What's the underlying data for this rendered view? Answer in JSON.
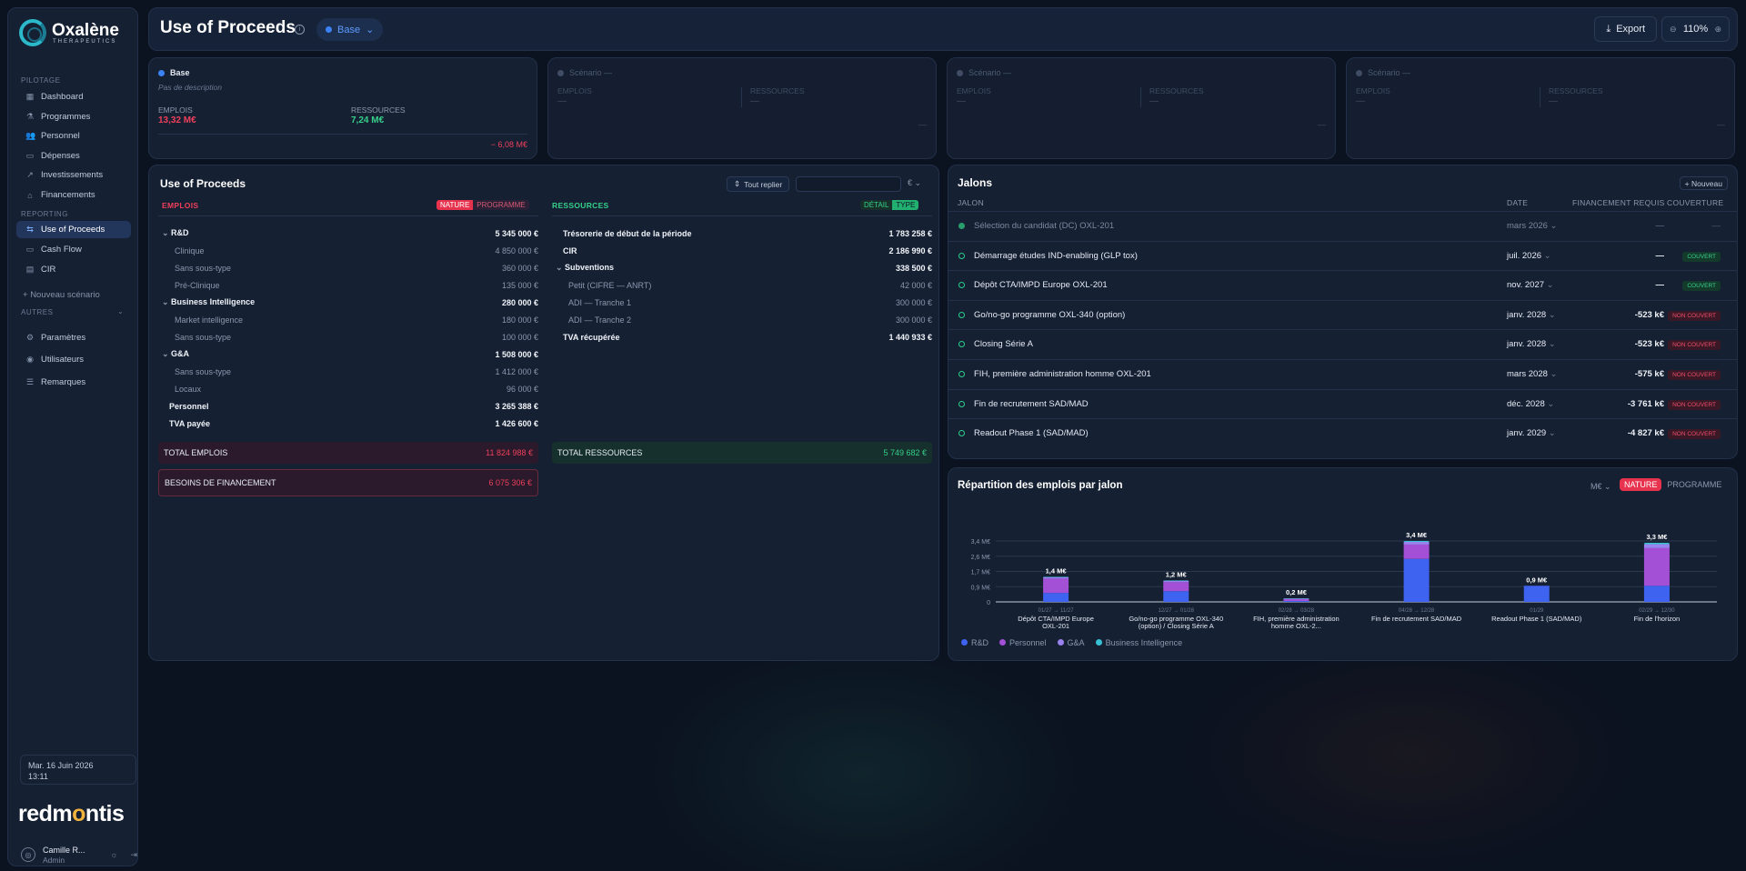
{
  "sidebar": {
    "logo_name": "Oxalène",
    "logo_sub": "THERAPEUTICS",
    "section_pilotage": "PILOTAGE",
    "section_reporting": "REPORTING",
    "section_autres": "AUTRES",
    "items": [
      {
        "label": "Dashboard",
        "icon": "grid-icon"
      },
      {
        "label": "Programmes",
        "icon": "flask-icon"
      },
      {
        "label": "Personnel",
        "icon": "users-icon"
      },
      {
        "label": "Dépenses",
        "icon": "wallet-icon"
      },
      {
        "label": "Investissements",
        "icon": "trend-icon"
      },
      {
        "label": "Financements",
        "icon": "bank-icon"
      },
      {
        "label": "Use of Proceeds",
        "icon": "split-icon"
      },
      {
        "label": "Cash Flow",
        "icon": "cash-icon"
      },
      {
        "label": "CIR",
        "icon": "document-icon"
      }
    ],
    "new_scenario": "Nouveau scénario",
    "other_items": [
      {
        "label": "Paramètres",
        "icon": "gear-icon"
      },
      {
        "label": "Utilisateurs",
        "icon": "user-icon"
      },
      {
        "label": "Remarques",
        "icon": "list-icon"
      }
    ],
    "date_line1": "Mar. 16 Juin 2026",
    "date_line2": "13:11",
    "brand": "redmontis",
    "user_name": "Camille R...",
    "user_role": "Admin"
  },
  "header": {
    "title": "Use of Proceeds",
    "scenario": "Base",
    "export_label": "Export",
    "zoom": "110%"
  },
  "scenarios": {
    "base": {
      "name": "Base",
      "desc": "Pas de description",
      "emplois_label": "EMPLOIS",
      "emplois": "13,32 M€",
      "ressources_label": "RESSOURCES",
      "ressources": "7,24 M€",
      "delta": "− 6,08 M€"
    },
    "empty": {
      "name": "Scénario —",
      "emplois_label": "EMPLOIS",
      "ressources_label": "RESSOURCES",
      "dash": "—"
    }
  },
  "uop": {
    "title": "Use of Proceeds",
    "fold_label": "Tout replier",
    "currency": "€",
    "emplois_head": "EMPLOIS",
    "ressources_head": "RESSOURCES",
    "toggle_nature": "NATURE",
    "toggle_programme": "PROGRAMME",
    "toggle_detail": "DÉTAIL",
    "toggle_type": "TYPE",
    "emplois_rows": [
      {
        "label": "R&D",
        "amount": "5 345 000 €",
        "level": "b",
        "caret": true
      },
      {
        "label": "Clinique",
        "amount": "4 850 000 €",
        "level": "s"
      },
      {
        "label": "Sans sous-type",
        "amount": "360 000 €",
        "level": "s"
      },
      {
        "label": "Pré-Clinique",
        "amount": "135 000 €",
        "level": "s"
      },
      {
        "label": "Business Intelligence",
        "amount": "280 000 €",
        "level": "b",
        "caret": true
      },
      {
        "label": "Market intelligence",
        "amount": "180 000 €",
        "level": "s"
      },
      {
        "label": "Sans sous-type",
        "amount": "100 000 €",
        "level": "s"
      },
      {
        "label": "G&A",
        "amount": "1 508 000 €",
        "level": "b",
        "caret": true
      },
      {
        "label": "Sans sous-type",
        "amount": "1 412 000 €",
        "level": "s"
      },
      {
        "label": "Locaux",
        "amount": "96 000 €",
        "level": "s"
      },
      {
        "label": "Personnel",
        "amount": "3 265 388 €",
        "level": "b"
      },
      {
        "label": "TVA payée",
        "amount": "1 426 600 €",
        "level": "b"
      }
    ],
    "ressources_rows": [
      {
        "label": "Trésorerie de début de la période",
        "amount": "1 783 258 €",
        "level": "b"
      },
      {
        "label": "CIR",
        "amount": "2 186 990 €",
        "level": "b"
      },
      {
        "label": "Subventions",
        "amount": "338 500 €",
        "level": "b",
        "caret": true
      },
      {
        "label": "Petit (CIFRE — ANRT)",
        "amount": "42 000 €",
        "level": "s"
      },
      {
        "label": "ADI — Tranche 1",
        "amount": "300 000 €",
        "level": "s"
      },
      {
        "label": "ADI — Tranche 2",
        "amount": "300 000 €",
        "level": "s"
      },
      {
        "label": "TVA récupérée",
        "amount": "1 440 933 €",
        "level": "b"
      }
    ],
    "total_emplois_label": "TOTAL EMPLOIS",
    "total_emplois": "11 824 988 €",
    "total_ressources_label": "TOTAL RESSOURCES",
    "total_ressources": "5 749 682 €",
    "besoins_label": "BESOINS DE FINANCEMENT",
    "besoins": "6 075 306 €"
  },
  "jalons": {
    "title": "Jalons",
    "new_label": "+ Nouveau",
    "col_jalon": "JALON",
    "col_date": "DATE",
    "col_fin": "FINANCEMENT REQUIS",
    "col_cov": "COUVERTURE",
    "rows": [
      {
        "name": "Sélection du candidat (DC) OXL-201",
        "date": "mars 2026",
        "amount": "—",
        "coverage": "—",
        "status": "done"
      },
      {
        "name": "Démarrage études IND-enabling (GLP tox)",
        "date": "juil. 2026",
        "amount": "—",
        "coverage": "COUVERT",
        "status": "ok"
      },
      {
        "name": "Dépôt CTA/IMPD Europe OXL-201",
        "date": "nov. 2027",
        "amount": "—",
        "coverage": "COUVERT",
        "status": "ok"
      },
      {
        "name": "Go/no-go programme OXL-340 (option)",
        "date": "janv. 2028",
        "amount": "-523 k€",
        "coverage": "NON COUVERT",
        "status": "ko"
      },
      {
        "name": "Closing Série A",
        "date": "janv. 2028",
        "amount": "-523 k€",
        "coverage": "NON COUVERT",
        "status": "ko"
      },
      {
        "name": "FIH, première administration homme OXL-201",
        "date": "mars 2028",
        "amount": "-575 k€",
        "coverage": "NON COUVERT",
        "status": "ko"
      },
      {
        "name": "Fin de recrutement SAD/MAD",
        "date": "déc. 2028",
        "amount": "-3 761 k€",
        "coverage": "NON COUVERT",
        "status": "ko"
      },
      {
        "name": "Readout Phase 1 (SAD/MAD)",
        "date": "janv. 2029",
        "amount": "-4 827 k€",
        "coverage": "NON COUVERT",
        "status": "ko"
      }
    ]
  },
  "chart_panel": {
    "title": "Répartition des emplois par jalon",
    "unit": "M€",
    "toggle_nature": "NATURE",
    "toggle_programme": "PROGRAMME"
  },
  "chart_data": {
    "type": "bar",
    "stacked": true,
    "ylim": [
      0,
      3.4
    ],
    "yticks": [
      "0",
      "0,9 M€",
      "1,7 M€",
      "2,6 M€",
      "3,4 M€"
    ],
    "categories": [
      "Dépôt CTA/IMPD Europe OXL-201",
      "Go/no-go programme OXL-340 (option) / Closing Série A",
      "FIH, première administration homme OXL-2...",
      "Fin de recrutement SAD/MAD",
      "Readout Phase 1 (SAD/MAD)",
      "Fin de l'horizon"
    ],
    "periods": [
      "01/27 → 11/27",
      "12/27 → 01/28",
      "02/28 → 03/28",
      "04/28 → 12/28",
      "01/29",
      "02/29 → 12/30"
    ],
    "totals": [
      1.4,
      1.2,
      0.2,
      3.4,
      0.9,
      3.3
    ],
    "total_labels": [
      "1,4 M€",
      "1,2 M€",
      "0,2 M€",
      "3,4 M€",
      "0,9 M€",
      "3,3 M€"
    ],
    "series": [
      {
        "name": "R&D",
        "color": "#3d63f0",
        "values": [
          0.5,
          0.6,
          0.05,
          2.4,
          0.9,
          0.9
        ]
      },
      {
        "name": "Personnel",
        "color": "#a34fd6",
        "values": [
          0.8,
          0.5,
          0.12,
          0.8,
          0.0,
          2.1
        ]
      },
      {
        "name": "G&A",
        "color": "#9a83ee",
        "values": [
          0.08,
          0.08,
          0.02,
          0.15,
          0.0,
          0.22
        ]
      },
      {
        "name": "Business Intelligence",
        "color": "#36c2d4",
        "values": [
          0.02,
          0.02,
          0.01,
          0.05,
          0.0,
          0.08
        ]
      }
    ]
  }
}
